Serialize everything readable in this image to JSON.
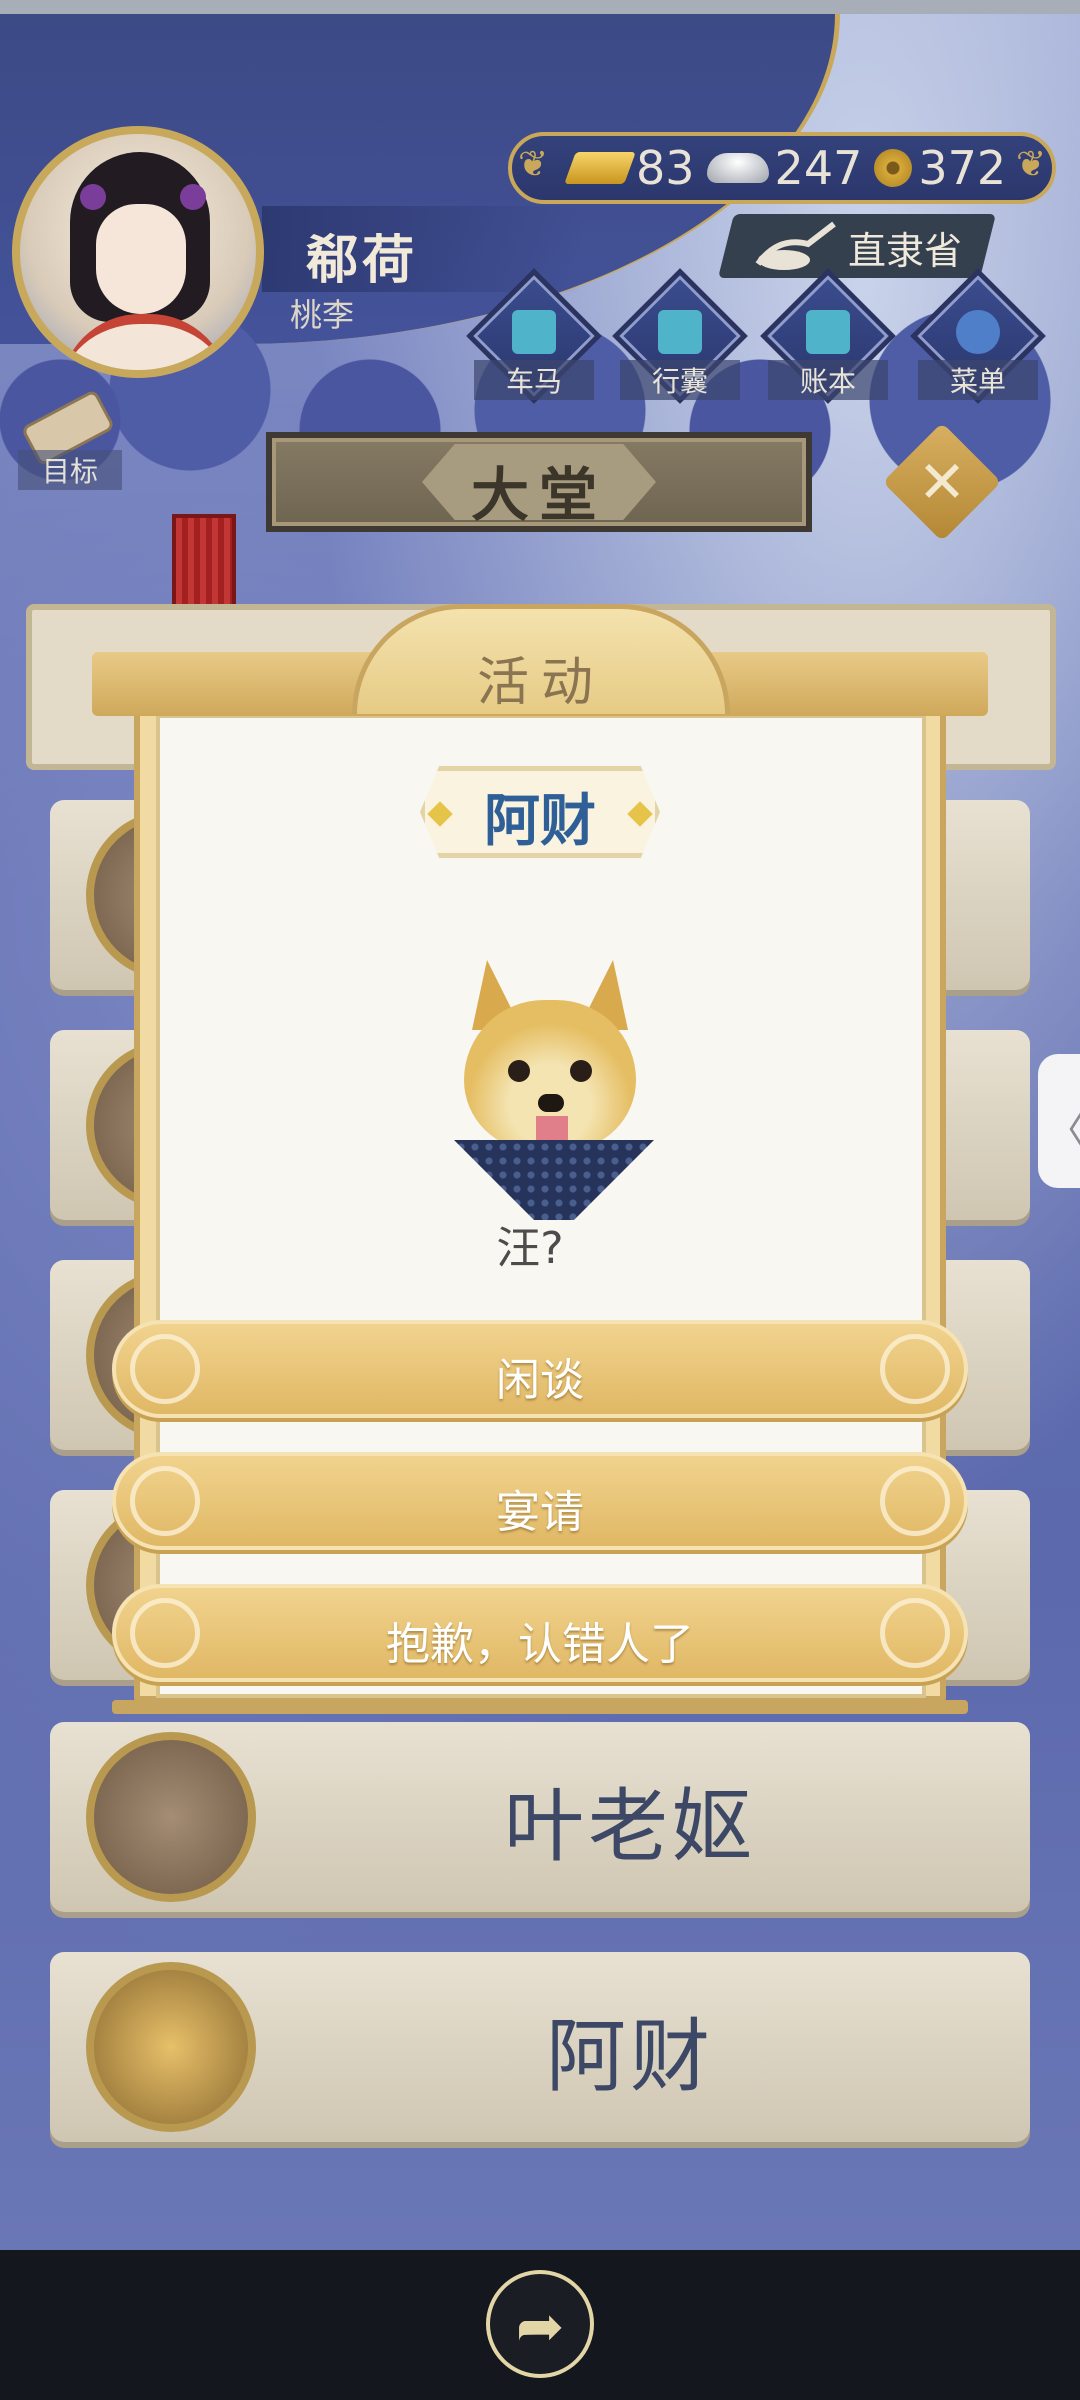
{
  "player": {
    "name": "郗荷",
    "subtitle": "桃李"
  },
  "currency": {
    "gold": "83",
    "silver": "247",
    "coins": "372"
  },
  "location": "直隶省",
  "menu": [
    {
      "label": "车马",
      "icon": "carriage-icon"
    },
    {
      "label": "行囊",
      "icon": "bag-icon"
    },
    {
      "label": "账本",
      "icon": "ledger-icon"
    },
    {
      "label": "菜单",
      "icon": "more-icon"
    }
  ],
  "target_label": "目标",
  "hall_title": "大堂",
  "background_cards": [
    {
      "name": "叶老妪"
    },
    {
      "name": "阿财"
    }
  ],
  "dialog": {
    "title": "活动",
    "npc_name": "阿财",
    "npc_line": "汪?",
    "options": [
      "闲谈",
      "宴请",
      "抱歉，认错人了"
    ]
  },
  "colors": {
    "gold": "#c9a85a",
    "panel": "#f9f7f1",
    "npc_name": "#2f5f97"
  }
}
